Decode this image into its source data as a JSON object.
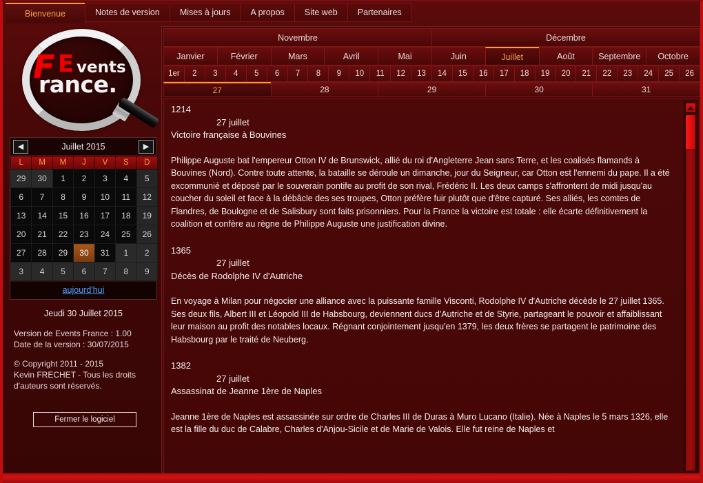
{
  "window": {
    "tabs": [
      {
        "label": "Bienvenue",
        "active": true
      },
      {
        "label": "Notes de version",
        "active": false
      },
      {
        "label": "Mises à jours",
        "active": false
      },
      {
        "label": "A propos",
        "active": false
      },
      {
        "label": "Site web",
        "active": false
      },
      {
        "label": "Partenaires",
        "active": false
      }
    ]
  },
  "logo": {
    "f": "F",
    "e": "E",
    "vents": "vents",
    "france": "rance."
  },
  "calendar": {
    "title": "Juillet 2015",
    "prev_icon": "left-arrow-icon",
    "next_icon": "right-arrow-icon",
    "weekdays": [
      "L",
      "M",
      "M",
      "J",
      "V",
      "S",
      "D"
    ],
    "weeks": [
      [
        {
          "d": "29",
          "t": "other"
        },
        {
          "d": "30",
          "t": "other"
        },
        {
          "d": "1",
          "t": "cur"
        },
        {
          "d": "2",
          "t": "cur"
        },
        {
          "d": "3",
          "t": "cur"
        },
        {
          "d": "4",
          "t": "cur"
        },
        {
          "d": "5",
          "t": "we"
        }
      ],
      [
        {
          "d": "6",
          "t": "cur"
        },
        {
          "d": "7",
          "t": "cur"
        },
        {
          "d": "8",
          "t": "cur"
        },
        {
          "d": "9",
          "t": "cur"
        },
        {
          "d": "10",
          "t": "cur"
        },
        {
          "d": "11",
          "t": "cur"
        },
        {
          "d": "12",
          "t": "we"
        }
      ],
      [
        {
          "d": "13",
          "t": "cur"
        },
        {
          "d": "14",
          "t": "cur"
        },
        {
          "d": "15",
          "t": "cur"
        },
        {
          "d": "16",
          "t": "cur"
        },
        {
          "d": "17",
          "t": "cur"
        },
        {
          "d": "18",
          "t": "cur"
        },
        {
          "d": "19",
          "t": "we"
        }
      ],
      [
        {
          "d": "20",
          "t": "cur"
        },
        {
          "d": "21",
          "t": "cur"
        },
        {
          "d": "22",
          "t": "cur"
        },
        {
          "d": "23",
          "t": "cur"
        },
        {
          "d": "24",
          "t": "cur"
        },
        {
          "d": "25",
          "t": "cur"
        },
        {
          "d": "26",
          "t": "we"
        }
      ],
      [
        {
          "d": "27",
          "t": "cur"
        },
        {
          "d": "28",
          "t": "cur"
        },
        {
          "d": "29",
          "t": "cur"
        },
        {
          "d": "30",
          "t": "today"
        },
        {
          "d": "31",
          "t": "cur"
        },
        {
          "d": "1",
          "t": "other"
        },
        {
          "d": "2",
          "t": "other"
        }
      ],
      [
        {
          "d": "3",
          "t": "other"
        },
        {
          "d": "4",
          "t": "other"
        },
        {
          "d": "5",
          "t": "other"
        },
        {
          "d": "6",
          "t": "other"
        },
        {
          "d": "7",
          "t": "other"
        },
        {
          "d": "8",
          "t": "other"
        },
        {
          "d": "9",
          "t": "other"
        }
      ]
    ],
    "today_link": "aujourd'hui"
  },
  "sidebar": {
    "today_line": "Jeudi 30 Juillet 2015",
    "version_line": "Version de Events France : 1.00",
    "version_date_line": "Date de la version : 30/07/2015",
    "copyright_line1": "© Copyright 2011 - 2015",
    "copyright_line2": "Kevin FRECHET - Tous les droits",
    "copyright_line3": "d'auteurs sont réservés.",
    "close_button": "Fermer le logiciel"
  },
  "main": {
    "months_top": [
      {
        "label": "Novembre",
        "active": false
      },
      {
        "label": "Décembre",
        "active": false
      }
    ],
    "months_bottom": [
      {
        "label": "Janvier",
        "active": false
      },
      {
        "label": "Février",
        "active": false
      },
      {
        "label": "Mars",
        "active": false
      },
      {
        "label": "Avril",
        "active": false
      },
      {
        "label": "Mai",
        "active": false
      },
      {
        "label": "Juin",
        "active": false
      },
      {
        "label": "Juillet",
        "active": true
      },
      {
        "label": "Août",
        "active": false
      },
      {
        "label": "Septembre",
        "active": false
      },
      {
        "label": "Octobre",
        "active": false
      }
    ],
    "days": [
      {
        "label": "1er",
        "active": false
      },
      {
        "label": "2",
        "active": false
      },
      {
        "label": "3",
        "active": false
      },
      {
        "label": "4",
        "active": false
      },
      {
        "label": "5",
        "active": false
      },
      {
        "label": "6",
        "active": false
      },
      {
        "label": "7",
        "active": false
      },
      {
        "label": "8",
        "active": false
      },
      {
        "label": "9",
        "active": false
      },
      {
        "label": "10",
        "active": false
      },
      {
        "label": "11",
        "active": false
      },
      {
        "label": "12",
        "active": false
      },
      {
        "label": "13",
        "active": false
      },
      {
        "label": "14",
        "active": false
      },
      {
        "label": "15",
        "active": false
      },
      {
        "label": "16",
        "active": false
      },
      {
        "label": "17",
        "active": false
      },
      {
        "label": "18",
        "active": false
      },
      {
        "label": "19",
        "active": false
      },
      {
        "label": "20",
        "active": false
      },
      {
        "label": "21",
        "active": false
      },
      {
        "label": "22",
        "active": false
      },
      {
        "label": "23",
        "active": false
      },
      {
        "label": "24",
        "active": false
      },
      {
        "label": "25",
        "active": false
      },
      {
        "label": "26",
        "active": false
      }
    ],
    "days_last": [
      {
        "label": "27",
        "active": true
      },
      {
        "label": "28",
        "active": false
      },
      {
        "label": "29",
        "active": false
      },
      {
        "label": "30",
        "active": false
      },
      {
        "label": "31",
        "active": false
      }
    ],
    "events": [
      {
        "year": "1214",
        "day": "27 juillet",
        "title": "Victoire française à Bouvines",
        "body": "Philippe Auguste bat l'empereur Otton IV de Brunswick, allié du roi d'Angleterre Jean sans Terre, et les coalisés flamands à Bouvines (Nord). Contre toute attente, la bataille se déroule un dimanche, jour du Seigneur, car Otton est l'ennemi du pape. Il a été excommunié et déposé par le souverain pontife au profit de son rival, Frédéric II. Les deux camps s'affrontent de midi jusqu'au coucher du soleil et face à la débâcle des ses troupes, Otton préfère fuir plutôt que d'être capturé. Ses alliés, les comtes de Flandres, de Boulogne et de Salisbury sont faits prisonniers. Pour la France la victoire est totale : elle écarte définitivement la coalition et confère au règne de Philippe Auguste une justification divine."
      },
      {
        "year": "1365",
        "day": "27 juillet",
        "title": "Décès de Rodolphe IV d'Autriche",
        "body": "En voyage à Milan pour négocier une alliance avec la puissante famille Visconti, Rodolphe IV d'Autriche décède le 27 juillet 1365. Ses deux fils, Albert III et Léopold III de Habsbourg, deviennent ducs d'Autriche et de Styrie, partageant le pouvoir et affaiblissant leur maison au profit des notables locaux. Régnant conjointement jusqu'en 1379, les deux frères se partagent le patrimoine des Habsbourg par le traité de Neuberg."
      },
      {
        "year": "1382",
        "day": "27 juillet",
        "title": "Assassinat de Jeanne 1ère de Naples",
        "body": "Jeanne 1ère de Naples est assassinée sur ordre de Charles III de Duras à Muro Lucano (Italie). Née à Naples le 5 mars 1326, elle est la fille du duc de Calabre, Charles d'Anjou-Sicile et de Marie de Valois. Elle fut reine de Naples et"
      }
    ],
    "scrollbar": {
      "up_icon": "scroll-up-arrow-icon",
      "down_icon": "scroll-down-arrow-icon"
    }
  },
  "colors": {
    "accent": "#ff9b3d",
    "brand_red": "#ee0000",
    "window_bg": "#4a0808",
    "link": "#4da3ff"
  }
}
